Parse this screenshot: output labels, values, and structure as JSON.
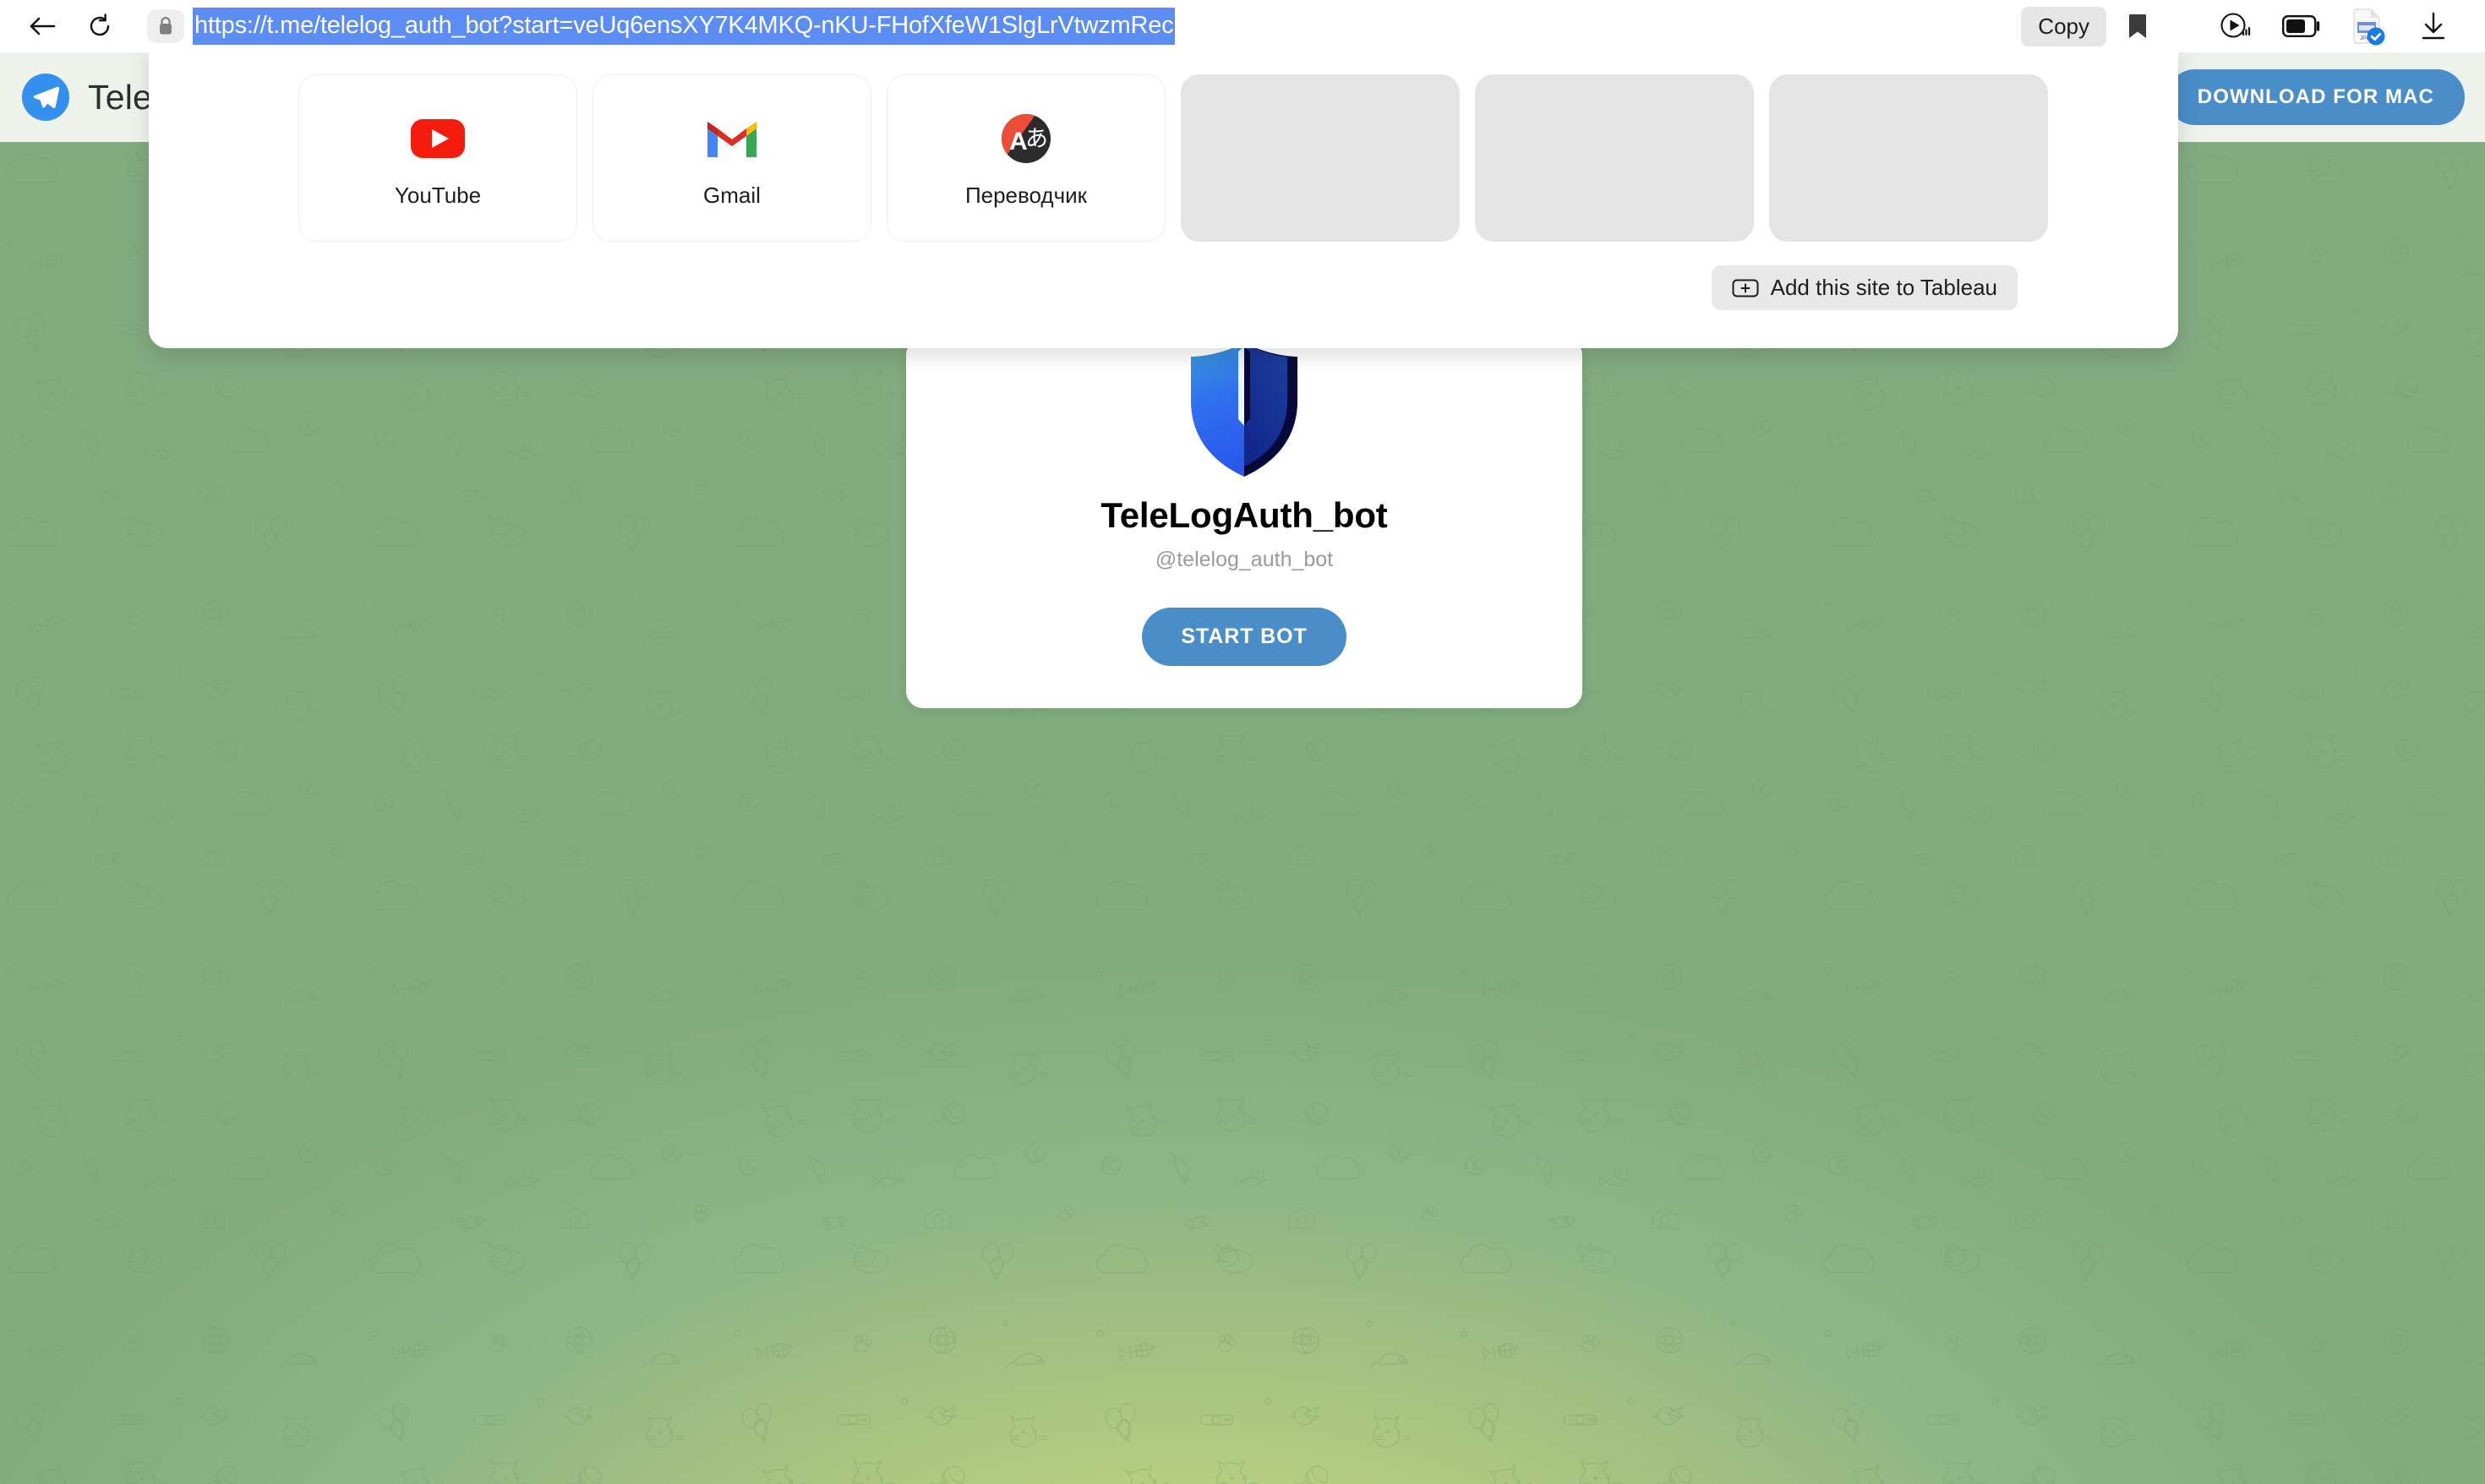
{
  "browser": {
    "back_icon": "arrow-left-icon",
    "reload_icon": "reload-icon",
    "lock_icon": "lock-icon",
    "url": "https://t.me/telelog_auth_bot?start=veUq6ensXY7K4MKQ-nKU-FHofXfeW1SlgLrVtwzmRec",
    "copy_label": "Copy",
    "bookmark_icon": "bookmark-icon",
    "system_icons": [
      "media-play-volume-icon",
      "battery-icon",
      "downloaded-file-check-icon",
      "download-arrow-icon"
    ],
    "accent_selection": "#5b8df5"
  },
  "shortcuts_panel": {
    "tiles": [
      {
        "label": "YouTube",
        "icon": "youtube-icon",
        "empty": false
      },
      {
        "label": "Gmail",
        "icon": "gmail-icon",
        "empty": false
      },
      {
        "label": "Переводчик",
        "icon": "translate-icon",
        "empty": false
      },
      {
        "label": "",
        "icon": "empty-tile",
        "empty": true
      },
      {
        "label": "",
        "icon": "empty-tile",
        "empty": true
      },
      {
        "label": "",
        "icon": "empty-tile",
        "empty": true
      }
    ],
    "add_site_label": "Add this site to Tableau",
    "add_site_icon": "plus-box-icon"
  },
  "telegram": {
    "logo_icon": "telegram-paperplane-icon",
    "wordmark": "Telegram",
    "download_button": "DOWNLOAD FOR MAC",
    "bot": {
      "avatar_icon": "telelog-shield-icon",
      "name": "TeleLogAuth_bot",
      "handle": "@telelog_auth_bot",
      "start_button": "START BOT"
    },
    "colors": {
      "brand_blue": "#3390ec",
      "button_blue": "#4a8ec9",
      "wallpaper_green": "#8fb686",
      "wallpaper_light": "#d7e08a"
    }
  }
}
